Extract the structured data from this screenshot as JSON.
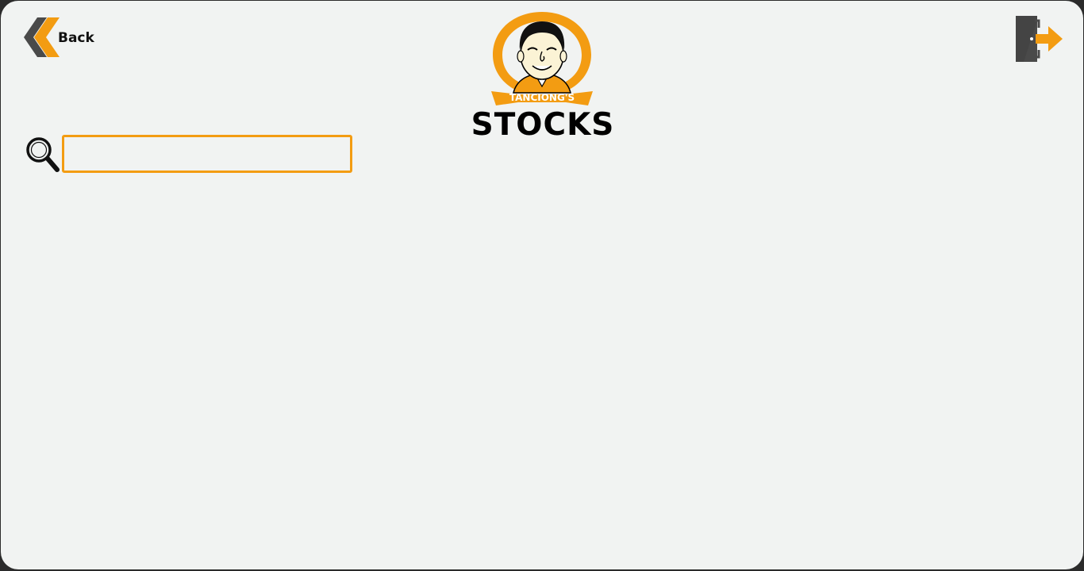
{
  "header": {
    "back_label": "Back",
    "logo_text": "TANCIONG'S",
    "title": "STOCKS"
  },
  "search": {
    "value": "",
    "placeholder": ""
  },
  "icons": {
    "back": "double-chevron-left-icon",
    "logout": "door-exit-icon",
    "search": "magnifier-icon",
    "logo": "mascot-logo"
  },
  "colors": {
    "accent": "#f39c12",
    "dark": "#4a4a4a",
    "background": "#f1f3f2",
    "frame": "#2b2b2b"
  }
}
